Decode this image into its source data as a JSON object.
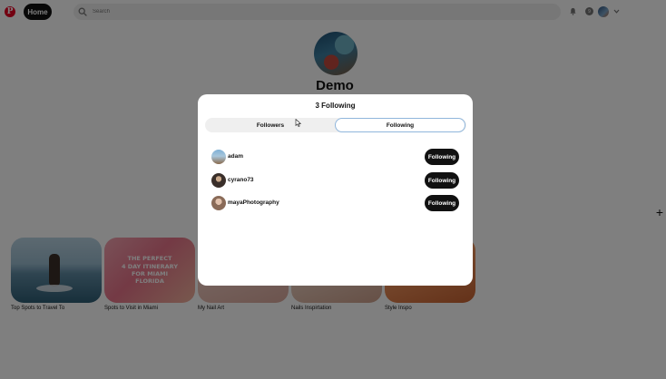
{
  "header": {
    "logo_glyph": "P",
    "home_label": "Home",
    "search_placeholder": "Search",
    "messages_count": "9"
  },
  "profile": {
    "name": "Demo"
  },
  "boards": [
    {
      "title": "Top Spots to Travel To"
    },
    {
      "title": "Spots to Visit in Miami",
      "thumb_text": "THE PERFECT\n4 DAY ITINERARY\nFOR MIAMI\nFLORIDA"
    },
    {
      "title": "My Nail Art"
    },
    {
      "title": "Nails Inspirtation"
    },
    {
      "title": "Style Inspo"
    }
  ],
  "modal": {
    "title": "3 Following",
    "tabs": [
      {
        "label": "Followers",
        "active": false
      },
      {
        "label": "Following",
        "active": true
      }
    ],
    "users": [
      {
        "name": "adam",
        "button": "Following"
      },
      {
        "name": "cyrano73",
        "button": "Following"
      },
      {
        "name": "mayaPhotography",
        "button": "Following"
      }
    ]
  },
  "colors": {
    "brand_red": "#e60023",
    "active_tab_border": "#8fb6dc",
    "button_black": "#111111"
  }
}
